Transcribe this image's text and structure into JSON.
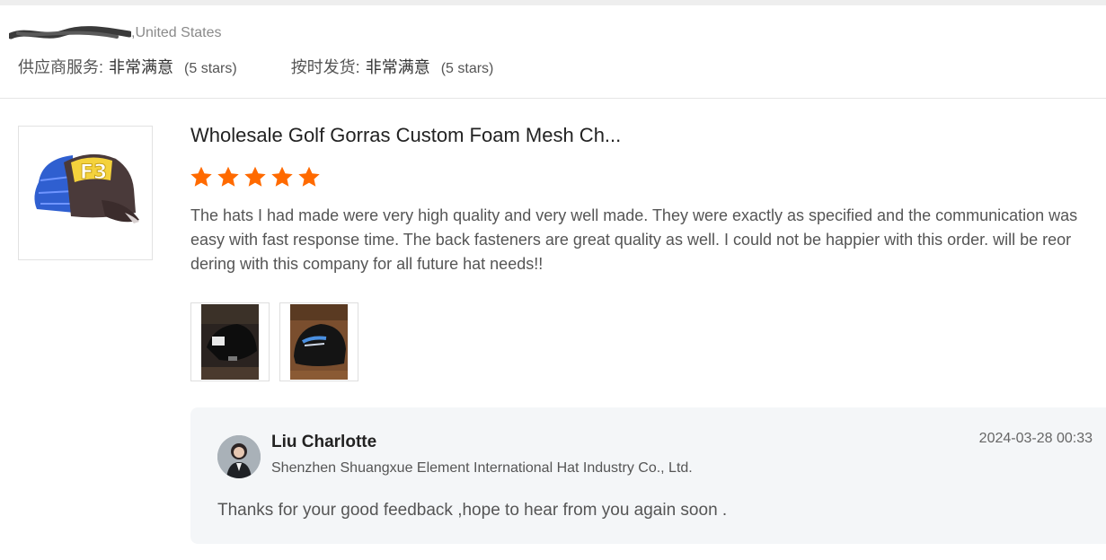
{
  "buyer": {
    "location": ",United States"
  },
  "supplier_ratings": [
    {
      "label": "供应商服务:",
      "value": "非常满意",
      "stars": "(5 stars)"
    },
    {
      "label": "按时发货:",
      "value": "非常满意",
      "stars": "(5 stars)"
    }
  ],
  "review": {
    "product_title": "Wholesale Golf Gorras Custom Foam Mesh Ch...",
    "rating": 5,
    "text": "The hats I had made were very high quality and very well made. They were exactly as specified and the communication was easy with fast response time. The back fasteners are great quality as well. I could not be happier with this order. will be reordering with this company for all future hat needs!!",
    "photos": [
      "review-photo-1",
      "review-photo-2"
    ]
  },
  "reply": {
    "seller_name": "Liu Charlotte",
    "company": "Shenzhen Shuangxue Element International Hat Industry Co., Ltd.",
    "time": "2024-03-28 00:33",
    "text": "Thanks for your good feedback ,hope to hear from you again soon ."
  },
  "colors": {
    "star": "#ff6a00",
    "reply_bg": "#f4f6f8",
    "divider": "#e6e6e6"
  }
}
